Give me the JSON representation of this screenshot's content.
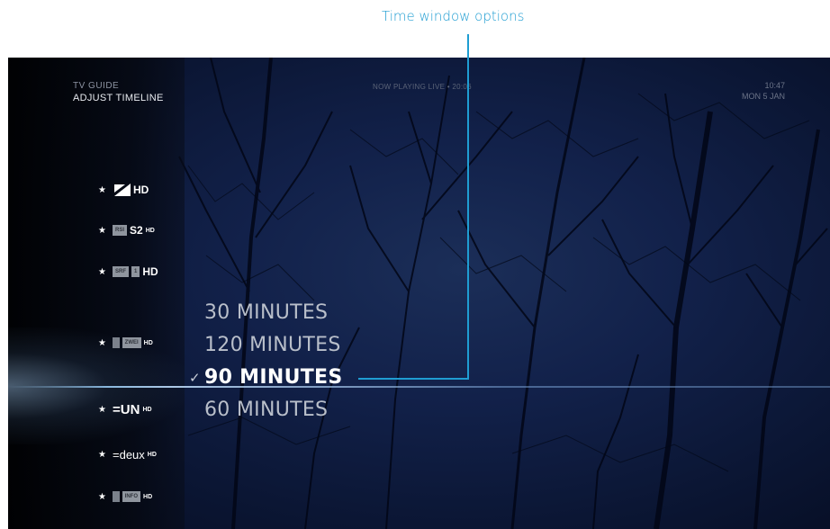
{
  "annotation": {
    "label": "Time window options"
  },
  "header": {
    "title": "TV GUIDE",
    "subtitle": "ADJUST TIMELINE",
    "now_playing": "NOW PLAYING LIVE • 20:06",
    "time": "10:47",
    "date": "MON 5 JAN"
  },
  "channels": [
    {
      "icon": "star-icon",
      "logo": "HD",
      "logo_box": "",
      "hd": ""
    },
    {
      "icon": "star-icon",
      "logo": "S2",
      "logo_box": "RSI",
      "hd": "HD"
    },
    {
      "icon": "star-icon",
      "logo": "1",
      "logo_box": "SRF",
      "hd": "HD"
    },
    {
      "icon": "star-icon",
      "logo": "",
      "logo_box": "ZWEI",
      "hd": "HD"
    },
    {
      "icon": "star-icon",
      "logo": "=UN",
      "logo_box": "",
      "hd": "HD"
    },
    {
      "icon": "star-icon",
      "logo": "=deux",
      "logo_box": "",
      "hd": "HD"
    },
    {
      "icon": "star-icon",
      "logo": "",
      "logo_box": "INFO",
      "hd": "HD"
    }
  ],
  "time_options": {
    "items": [
      "30 MINUTES",
      "120 MINUTES",
      "90 MINUTES",
      "60 MINUTES"
    ],
    "selected": "90 MINUTES",
    "check_icon": "check-icon"
  },
  "colors": {
    "accent": "#1f9dd2",
    "background": "#0f1c40",
    "selected_text": "#ffffff",
    "option_text": "#b9bfca"
  }
}
